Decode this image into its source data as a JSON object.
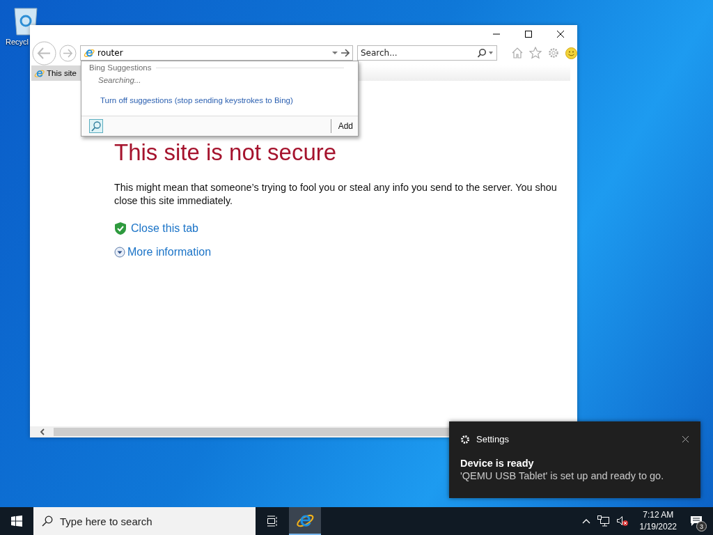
{
  "desktop": {
    "icons": [
      {
        "label": "Recycl"
      }
    ]
  },
  "browser": {
    "address": {
      "value": "router"
    },
    "search": {
      "placeholder": "Search..."
    },
    "tabs": [
      {
        "label": "This site",
        "selected": true
      }
    ],
    "suggestions": {
      "heading": "Bing Suggestions",
      "status": "Searching...",
      "link": "Turn off suggestions (stop sending keystrokes to Bing)",
      "add": "Add"
    },
    "page": {
      "title": "This site is not secure",
      "lines": [
        "This might mean that someone’s trying to fool you or steal any info you send to the server. You shou",
        "close this site immediately."
      ],
      "actions": [
        {
          "label": "Close this tab",
          "kind": "shield"
        },
        {
          "label": "More information",
          "kind": "expand"
        }
      ]
    }
  },
  "notification": {
    "app": "Settings",
    "title": "Device is ready",
    "body": "'QEMU USB Tablet' is set up and ready to go."
  },
  "taskbar": {
    "search_placeholder": "Type here to search",
    "apps": [
      {
        "kind": "ie",
        "selected": true
      }
    ],
    "tray": {
      "time": "7:12 AM",
      "date": "1/19/2022",
      "notification_count": "3"
    }
  }
}
